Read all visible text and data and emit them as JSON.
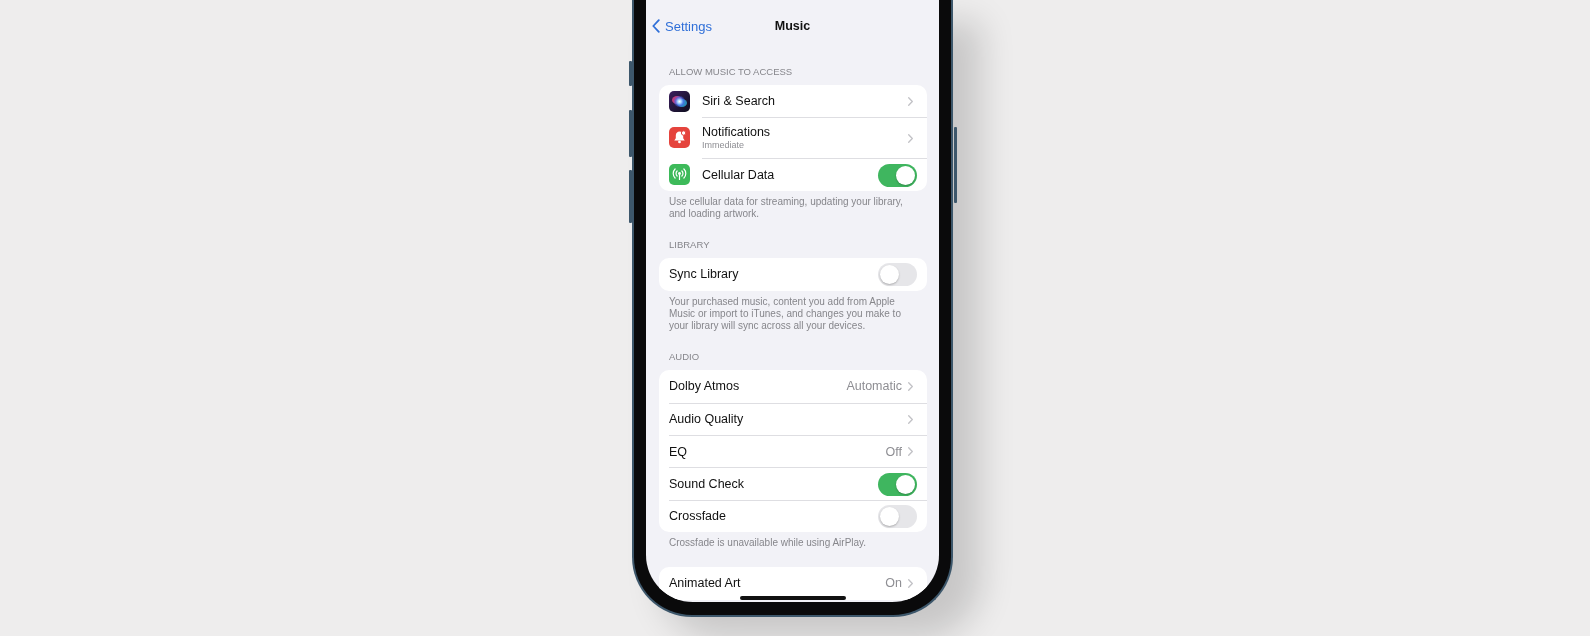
{
  "nav": {
    "back": "Settings",
    "title": "Music"
  },
  "sections": [
    {
      "header": "ALLOW MUSIC TO ACCESS",
      "rows": [
        {
          "kind": "link",
          "label": "Siri & Search"
        },
        {
          "kind": "link",
          "label": "Notifications",
          "subtitle": "Immediate"
        },
        {
          "kind": "toggle",
          "label": "Cellular Data",
          "on": true
        }
      ],
      "footer": "Use cellular data for streaming, updating your library, and loading artwork."
    },
    {
      "header": "LIBRARY",
      "rows": [
        {
          "kind": "toggle",
          "label": "Sync Library",
          "on": false
        }
      ],
      "footer": "Your purchased music, content you add from Apple Music or import to iTunes, and changes you make to your library will sync across all your devices."
    },
    {
      "header": "AUDIO",
      "rows": [
        {
          "kind": "link",
          "label": "Dolby Atmos",
          "value": "Automatic"
        },
        {
          "kind": "link",
          "label": "Audio Quality"
        },
        {
          "kind": "link",
          "label": "EQ",
          "value": "Off"
        },
        {
          "kind": "toggle",
          "label": "Sound Check",
          "on": true
        },
        {
          "kind": "toggle",
          "label": "Crossfade",
          "on": false
        }
      ],
      "footer": "Crossfade is unavailable while using AirPlay."
    },
    {
      "rows": [
        {
          "kind": "link",
          "label": "Animated Art",
          "value": "On"
        }
      ]
    }
  ]
}
